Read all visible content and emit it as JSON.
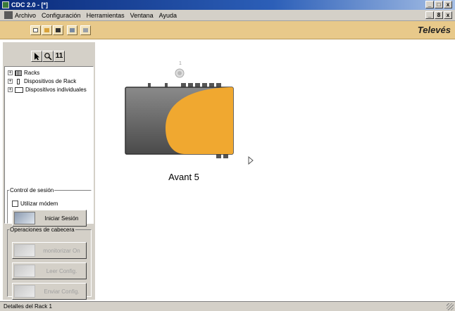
{
  "window": {
    "title": "CDC 2.0 - [*]",
    "controls": [
      "_",
      "□",
      "x"
    ]
  },
  "menubar": {
    "items": [
      "Archivo",
      "Configuración",
      "Herramientas",
      "Ventana",
      "Ayuda"
    ],
    "mdi_controls": [
      "_",
      "8",
      "x"
    ]
  },
  "toolbar": {
    "brand": "Televés",
    "buttons": [
      "new-document-icon",
      "open-folder-icon",
      "save-icon",
      "rack-icon",
      "device-icon"
    ]
  },
  "left_panel": {
    "tools": [
      "pointer-icon",
      "zoom-icon",
      "numbering-icon"
    ],
    "tool_labels": [
      "",
      "",
      "11"
    ],
    "tree": [
      {
        "label": "Racks",
        "expand": "+"
      },
      {
        "label": "Dispositivos de Rack",
        "expand": "+"
      },
      {
        "label": "Dispositivos individuales",
        "expand": "+"
      }
    ],
    "session": {
      "title": "Control de sesión",
      "modem_label": "Utilizar módem",
      "modem_checked": false,
      "login_button": "Iniciar Sesión"
    },
    "headend": {
      "title": "Operaciones de cabecera",
      "buttons": [
        "monitorizar On",
        "Leer Config.",
        "Enviar Config."
      ]
    }
  },
  "canvas": {
    "device_label": "Avant 5",
    "device_index": "1",
    "colors": {
      "body": "#6e6e6e",
      "accent": "#f0a830"
    }
  },
  "statusbar": {
    "text": "Detalles del Rack 1"
  }
}
